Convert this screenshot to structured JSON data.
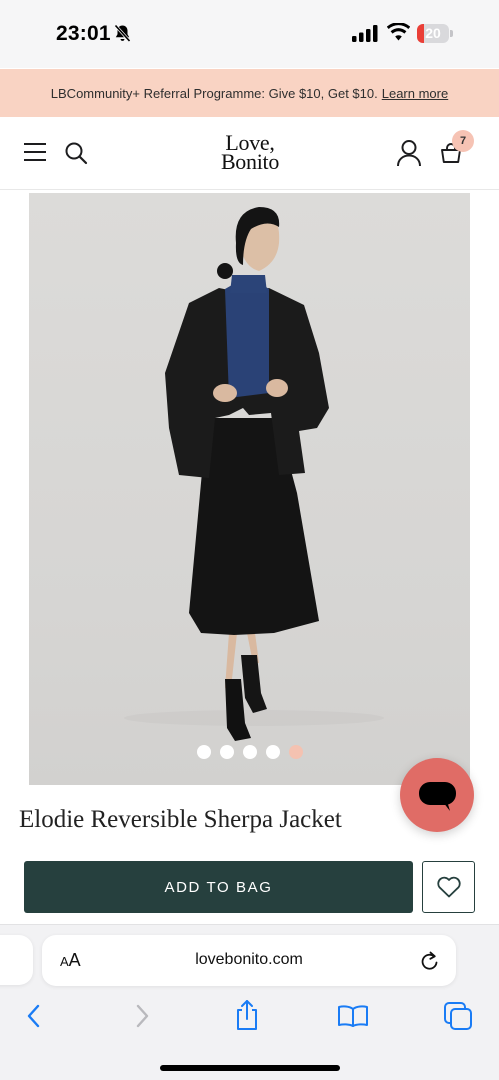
{
  "status_bar": {
    "time": "23:01",
    "battery_level": "20"
  },
  "promo": {
    "text": "LBCommunity+ Referral Programme: Give $10, Get $10.",
    "link": "Learn more"
  },
  "header": {
    "logo_line1": "Love,",
    "logo_line2": "Bonito",
    "bag_count": "7"
  },
  "product": {
    "title": "Elodie Reversible Sherpa Jacket",
    "add_to_bag_label": "ADD TO BAG",
    "gallery_total": 5,
    "gallery_active_index": 4
  },
  "browser": {
    "text_size_label": "AA",
    "url": "lovebonito.com"
  },
  "colors": {
    "accent": "#26403e",
    "promo_bg": "#f9d3c3",
    "chat": "#e06c66",
    "safari_blue": "#1a7cf5"
  }
}
